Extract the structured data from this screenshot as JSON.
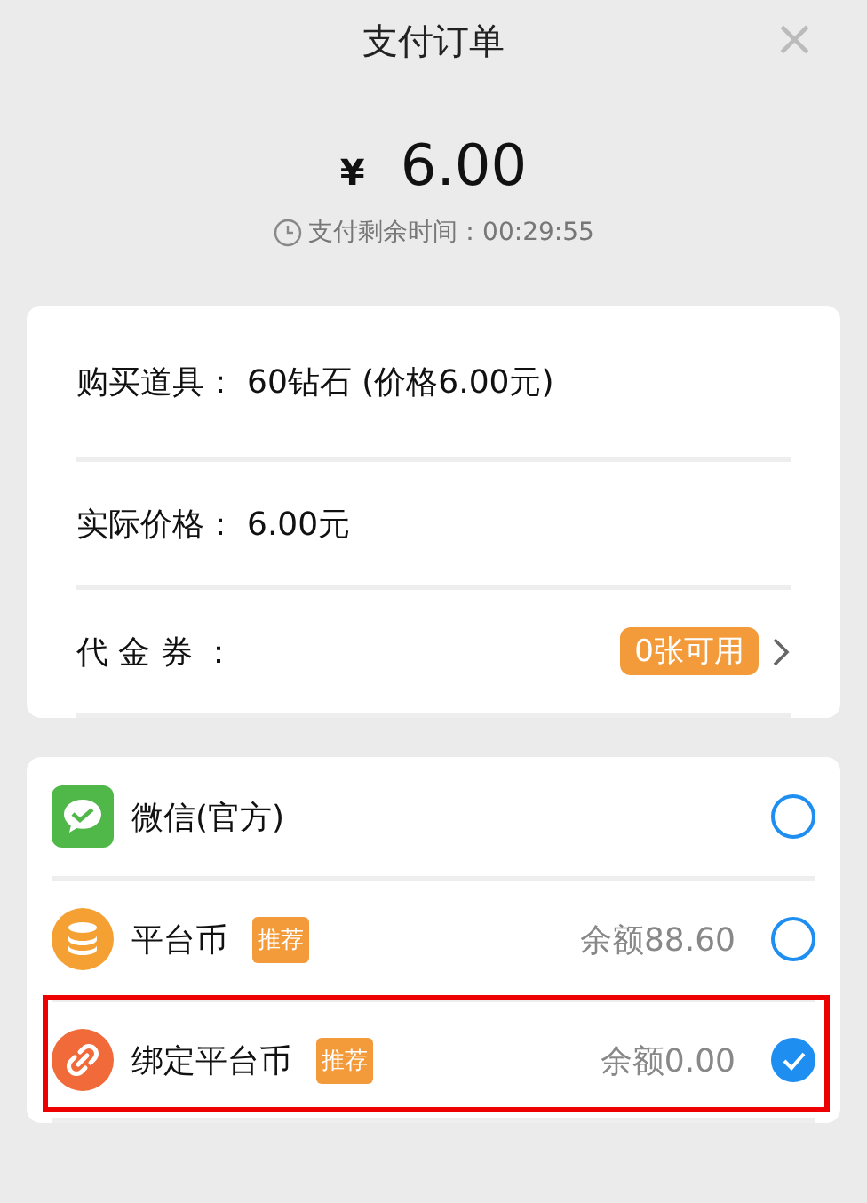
{
  "header": {
    "title": "支付订单",
    "close": "×"
  },
  "amount": {
    "currency": "¥",
    "value": "6.00",
    "timer": "支付剩余时间：00:29:55"
  },
  "order": [
    {
      "kind": "info",
      "label": "购买道具：",
      "value": "60钻石 (价格6.00元)"
    },
    {
      "kind": "info",
      "label": "实际价格：",
      "value": "6.00元"
    },
    {
      "kind": "voucher",
      "label": "代 金 券 ：",
      "value": "0张可用"
    }
  ],
  "methods": [
    {
      "kind": "wechat",
      "name": "微信(官方)",
      "selected": false,
      "highlighted": false
    },
    {
      "kind": "coin",
      "name": "平台币",
      "tag": "推荐",
      "balance": "余额88.60",
      "selected": false,
      "highlighted": false
    },
    {
      "kind": "link",
      "name": "绑定平台币",
      "tag": "推荐",
      "balance": "余额0.00",
      "selected": true,
      "highlighted": true
    }
  ]
}
